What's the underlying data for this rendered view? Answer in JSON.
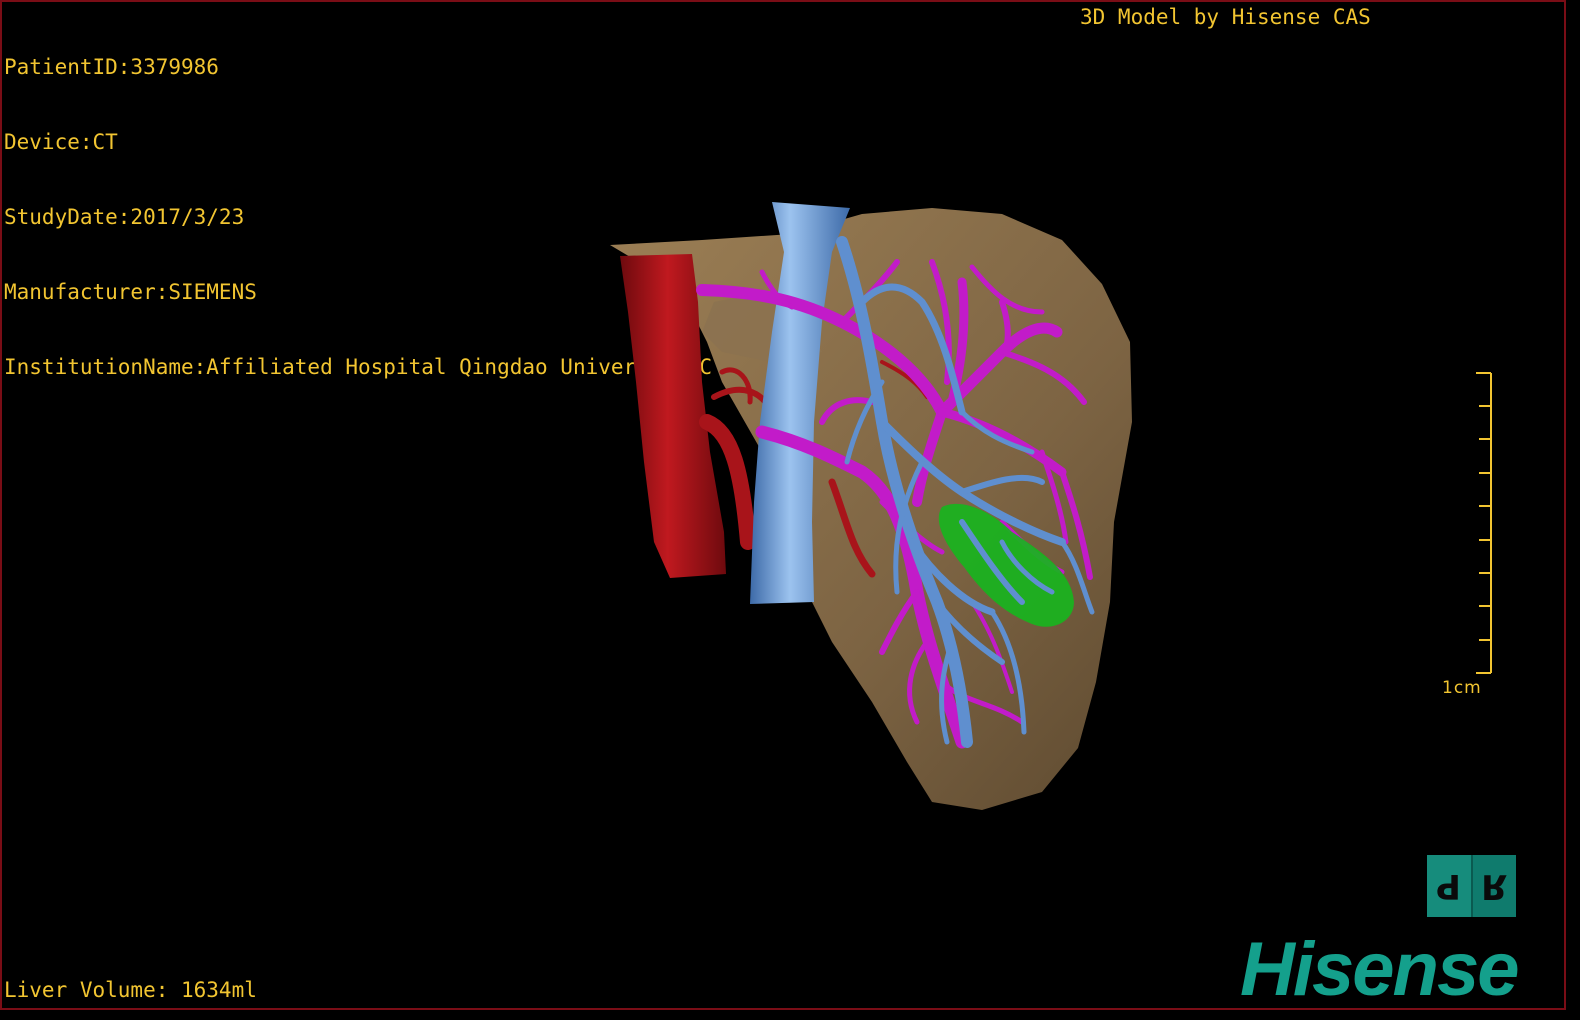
{
  "header": {
    "patient_id": "PatientID:3379986",
    "device": "Device:CT",
    "study_date": "StudyDate:2017/3/23",
    "manufacturer": "Manufacturer:SIEMENS",
    "institution": "InstitutionName:Affiliated Hospital Qingdao University-C",
    "model_credit": "3D Model by Hisense CAS"
  },
  "footer": {
    "liver_volume": "Liver Volume: 1634ml"
  },
  "scale_bar": {
    "label": "1cm"
  },
  "orientation_cube": {
    "left_face": "P",
    "right_face": "R"
  },
  "brand": {
    "name": "Hisense"
  },
  "colors": {
    "overlay_text": "#f2c531",
    "liver": "#8a6f48",
    "aorta": "#a8141a",
    "vena_cava": "#6e9fd8",
    "portal_vein": "#c21bc9",
    "hepatic_vein": "#5f8fcf",
    "lesion": "#18b41e",
    "brand": "#14a08c",
    "viewport_border": "#7a0d16"
  },
  "icons": {
    "orientation_cube": "orientation-cube-icon",
    "scale": "scale-ruler-icon"
  }
}
